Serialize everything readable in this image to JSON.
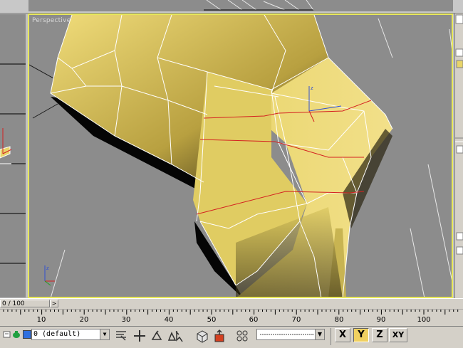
{
  "viewport": {
    "label": "Perspective"
  },
  "time_slider": {
    "position": "0 / 100",
    "arrow": ">"
  },
  "ruler": {
    "ticks": [
      "10",
      "20",
      "30",
      "40",
      "50",
      "60",
      "70",
      "80",
      "90",
      "100"
    ]
  },
  "layer": {
    "value": "0 (default)"
  },
  "axis": {
    "x": "X",
    "y": "Y",
    "z": "Z",
    "xy": "XY",
    "active": "Y"
  },
  "colors": {
    "model": "#e8d46a",
    "edge_highlight": "#d42020",
    "viewport_border": "#e8e85a"
  }
}
